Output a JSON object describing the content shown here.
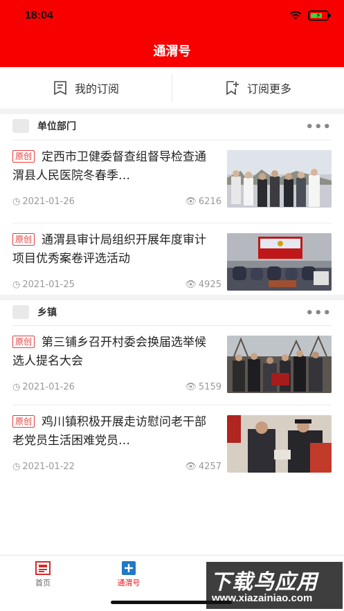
{
  "status_bar": {
    "time": "18:04"
  },
  "header": {
    "title": "通渭号",
    "background": "#f90000"
  },
  "subscribe": {
    "mine_label": "我的订阅",
    "more_label": "订阅更多"
  },
  "sections": [
    {
      "title": "单位部门",
      "articles": [
        {
          "tag": "原创",
          "title": "定西市卫健委督查组督导检查通渭县人民医院冬春季…",
          "date": "2021-01-26",
          "views": "6216"
        },
        {
          "tag": "原创",
          "title": "通渭县审计局组织开展年度审计项目优秀案卷评选活动",
          "date": "2021-01-25",
          "views": "4925"
        }
      ]
    },
    {
      "title": "乡镇",
      "articles": [
        {
          "tag": "原创",
          "title": "第三铺乡召开村委会换届选举候选人提名大会",
          "date": "2021-01-26",
          "views": "5159"
        },
        {
          "tag": "原创",
          "title": "鸡川镇积极开展走访慰问老干部老党员生活困难党员…",
          "date": "2021-01-22",
          "views": "4257"
        }
      ]
    }
  ],
  "tabbar": {
    "items": [
      {
        "label": "首页",
        "icon": "news-icon",
        "active": false
      },
      {
        "label": "通渭号",
        "icon": "plus-square-icon",
        "active": true
      }
    ],
    "active_color": "#e01b1b"
  },
  "watermark": {
    "main": "下载鸟应用",
    "url": "www.xiazainiao.com"
  }
}
